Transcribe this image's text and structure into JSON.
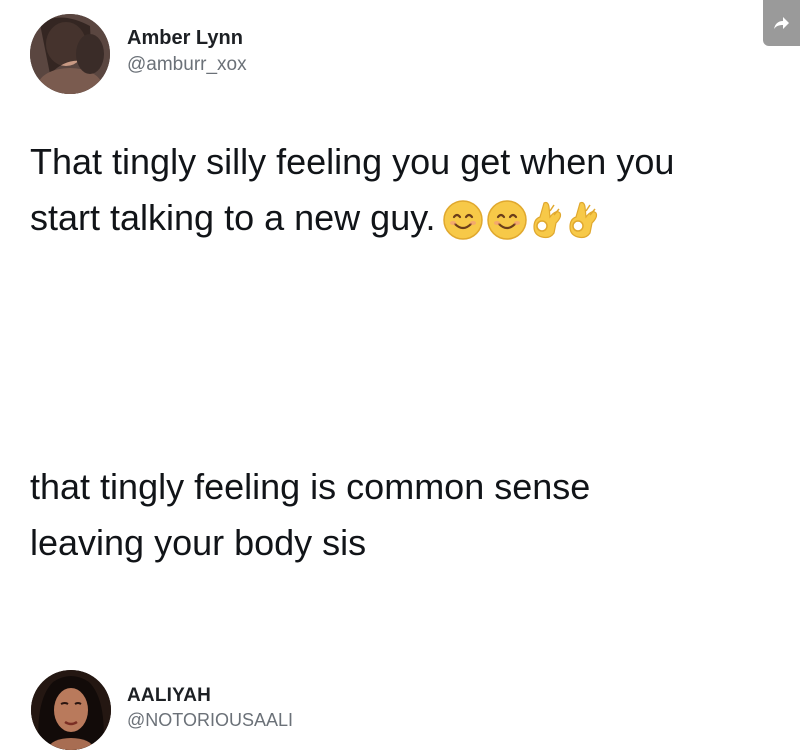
{
  "tweets": [
    {
      "author_name": "Amber Lynn",
      "author_handle": "@amburr_xox",
      "lines": [
        "That tingly silly feeling you get when you",
        "start talking to a new guy."
      ],
      "emojis": [
        "smiling-face-icon",
        "smiling-face-icon",
        "ok-hand-icon",
        "ok-hand-icon"
      ]
    },
    {
      "author_name": "AALIYAH",
      "author_handle": "@NOTORIOUSAALI",
      "lines": [
        "that tingly feeling is common sense",
        "leaving your body sis"
      ]
    }
  ],
  "share": {
    "icon": "share-arrow-icon"
  },
  "colors": {
    "share_bg": "#9a9a9a",
    "handle": "#6b7178",
    "text": "#111418",
    "emoji_yellow": "#f7c948"
  }
}
